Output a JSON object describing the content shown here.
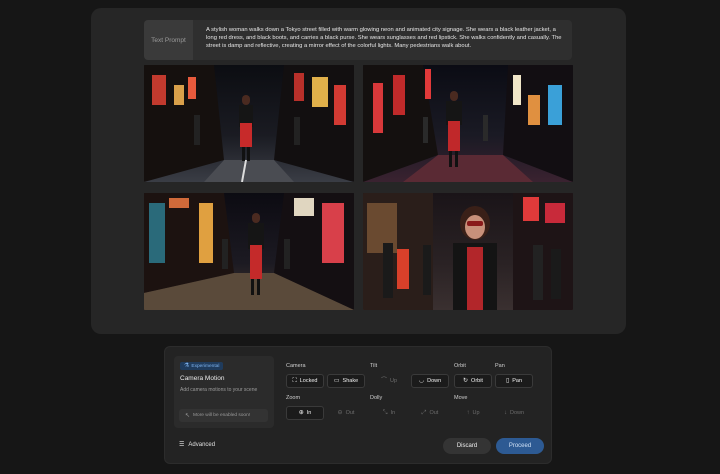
{
  "prompt": {
    "label": "Text Prompt",
    "text": "A stylish woman walks down a Tokyo street filled with warm glowing neon and animated city signage. She wears a black leather jacket, a long red dress, and black boots, and carries a black purse. She wears sunglasses and red lipstick. She walks confidently and casually. The street is damp and reflective, creating a mirror effect of the colorful lights. Many pedestrians walk about."
  },
  "motion": {
    "badge": "Experimental",
    "title": "Camera Motion",
    "subtitle": "Add camera motions to your scene",
    "note": "More will be enabled soon!"
  },
  "groups": {
    "camera": "Camera",
    "tilt": "Tilt",
    "orbit": "Orbit",
    "pan": "Pan",
    "zoom": "Zoom",
    "dolly": "Dolly",
    "move": "Move"
  },
  "buttons": {
    "locked": "Locked",
    "shake": "Shake",
    "tilt_up": "Up",
    "tilt_down": "Down",
    "orbit": "Orbit",
    "pan": "Pan",
    "zoom_in": "In",
    "zoom_out": "Out",
    "dolly_in": "In",
    "dolly_out": "Out",
    "move_up": "Up",
    "move_down": "Down"
  },
  "footer": {
    "advanced": "Advanced",
    "discard": "Discard",
    "proceed": "Proceed"
  },
  "colors": {
    "accent": "#2d5a93",
    "badge": "#1f3b5c",
    "neon_red": "#e2343b"
  }
}
